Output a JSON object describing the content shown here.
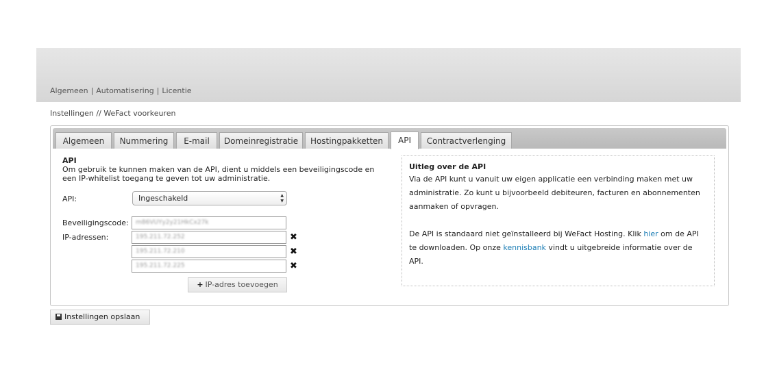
{
  "topnav": {
    "items": [
      "Algemeen",
      "Automatisering",
      "Licentie"
    ]
  },
  "breadcrumb": {
    "root": "Instellingen",
    "separator": "//",
    "current": "WeFact voorkeuren"
  },
  "tabs": [
    "Algemeen",
    "Nummering",
    "E-mail",
    "Domeinregistratie",
    "Hostingpakketten",
    "API",
    "Contractverlenging"
  ],
  "active_tab": "API",
  "api_section": {
    "title": "API",
    "intro": "Om gebruik te kunnen maken van de API, dient u middels een beveiligingscode en een IP-whitelist toegang te geven tot uw administratie.",
    "api_label": "API:",
    "api_value": "Ingeschakeld",
    "code_label": "Beveiligingscode:",
    "code_value": "m86VUYy2y21HkCx27k",
    "ip_label": "IP-adressen:",
    "ip_values": [
      "195.211.72.252",
      "195.211.72.210",
      "195.211.72.225"
    ],
    "add_ip_label": "IP-adres toevoegen"
  },
  "info": {
    "title": "Uitleg over de API",
    "p1": "Via de API kunt u vanuit uw eigen applicatie een verbinding maken met uw administratie. Zo kunt u bijvoorbeeld debiteuren, facturen en abonnementen aanmaken of opvragen.",
    "p2_before": "De API is standaard niet geïnstalleerd bij WeFact Hosting. Klik ",
    "p2_link1": "hier",
    "p2_middle": " om de API te downloaden. Op onze ",
    "p2_link2": "kennisbank",
    "p2_after": " vindt u uitgebreide informatie over de API."
  },
  "save_label": "Instellingen opslaan",
  "icons": {
    "delete": "close-icon",
    "add": "plus-icon",
    "save": "floppy-icon",
    "select": "select-arrows-icon"
  },
  "colors": {
    "link": "#1f7fb6",
    "header_bg": "#dcdcdc"
  }
}
